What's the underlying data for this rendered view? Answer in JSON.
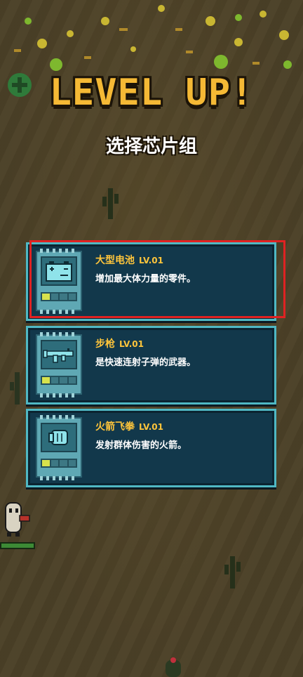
{
  "header": {
    "title": "LEVEL UP!",
    "subtitle": "选择芯片组"
  },
  "chips": [
    {
      "name": "大型电池",
      "level": "LV.01",
      "description": "增加最大体力量的零件。",
      "icon": "battery-icon"
    },
    {
      "name": "步枪",
      "level": "LV.01",
      "description": "是快速连射子弹的武器。",
      "icon": "rifle-icon"
    },
    {
      "name": "火箭飞拳",
      "level": "LV.01",
      "description": "发射群体伤害的火箭。",
      "icon": "rocket-fist-icon"
    }
  ],
  "colors": {
    "title": "#f5b935",
    "chip_name": "#ffc53b",
    "card_bg": "#12384b",
    "card_border": "#4fb8c4",
    "selection": "#e02222",
    "bar_filled": "#d7e24c"
  },
  "chip_level_bars": {
    "filled": 1,
    "total": 4
  }
}
